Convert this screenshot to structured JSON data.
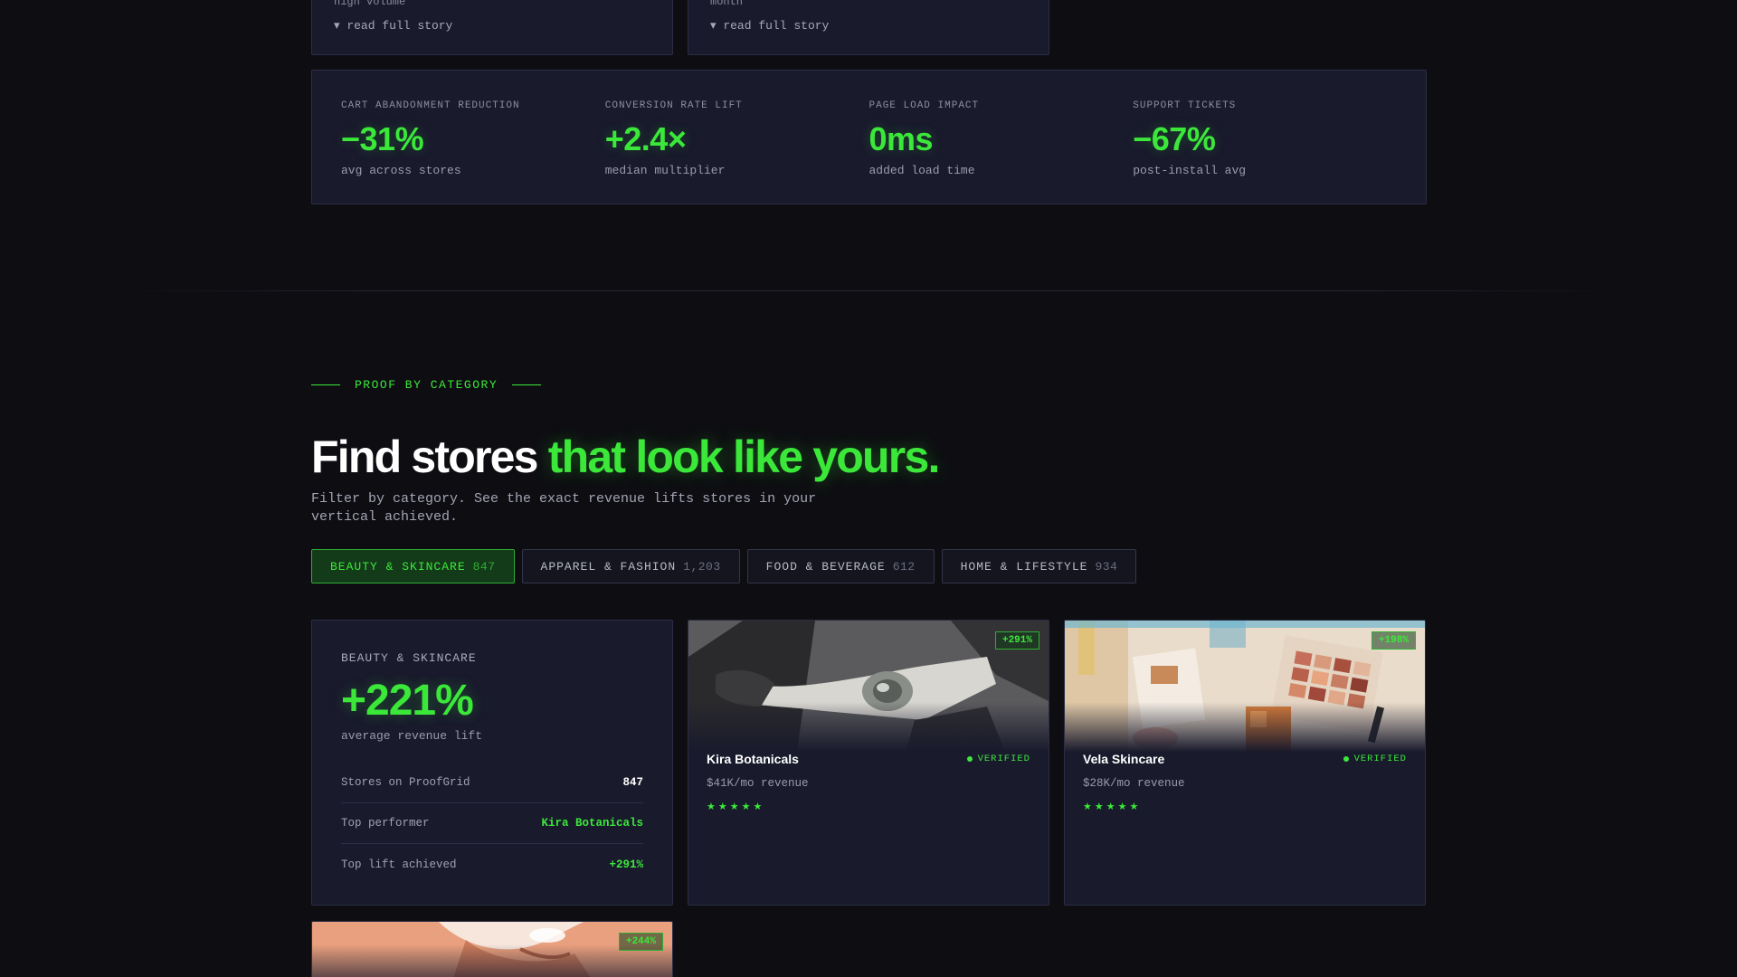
{
  "stories": [
    {
      "cut_text": "high volume",
      "toggle": "▾ read full story"
    },
    {
      "cut_text": "month",
      "toggle": "▾ read full story"
    }
  ],
  "stats": [
    {
      "label": "CART ABANDONMENT REDUCTION",
      "value": "−31%",
      "sub": "avg across stores"
    },
    {
      "label": "CONVERSION RATE LIFT",
      "value": "+2.4×",
      "sub": "median multiplier"
    },
    {
      "label": "PAGE LOAD IMPACT",
      "value": "0ms",
      "sub": "added load time"
    },
    {
      "label": "SUPPORT TICKETS",
      "value": "−67%",
      "sub": "post-install avg"
    }
  ],
  "section": {
    "eyebrow": "PROOF BY CATEGORY",
    "headline_white": "Find stores ",
    "headline_accent": "that look like yours.",
    "subtext": "Filter by category. See the exact revenue lifts stores in your vertical achieved."
  },
  "tabs": [
    {
      "label": "BEAUTY & SKINCARE",
      "count": "847",
      "active": true
    },
    {
      "label": "APPAREL & FASHION",
      "count": "1,203",
      "active": false
    },
    {
      "label": "FOOD & BEVERAGE",
      "count": "612",
      "active": false
    },
    {
      "label": "HOME & LIFESTYLE",
      "count": "934",
      "active": false
    }
  ],
  "summary": {
    "category": "BEAUTY & SKINCARE",
    "value": "+221%",
    "value_label": "average revenue lift",
    "rows": [
      {
        "label": "Stores on ProofGrid",
        "value": "847"
      },
      {
        "label": "Top performer",
        "value": "Kira Botanicals"
      },
      {
        "label": "Top lift achieved",
        "value": "+291%"
      }
    ]
  },
  "stores": [
    {
      "name": "Kira Botanicals",
      "badge": "+291%",
      "verified": "VERIFIED",
      "revenue": "$41K/mo revenue",
      "stars": "★★★★★"
    },
    {
      "name": "Vela Skincare",
      "badge": "+198%",
      "verified": "VERIFIED",
      "revenue": "$28K/mo revenue",
      "stars": "★★★★★"
    },
    {
      "badge": "+244%"
    }
  ],
  "colors": {
    "accent": "#3be83a",
    "card": "#191a2c",
    "background": "#0e0e12"
  }
}
